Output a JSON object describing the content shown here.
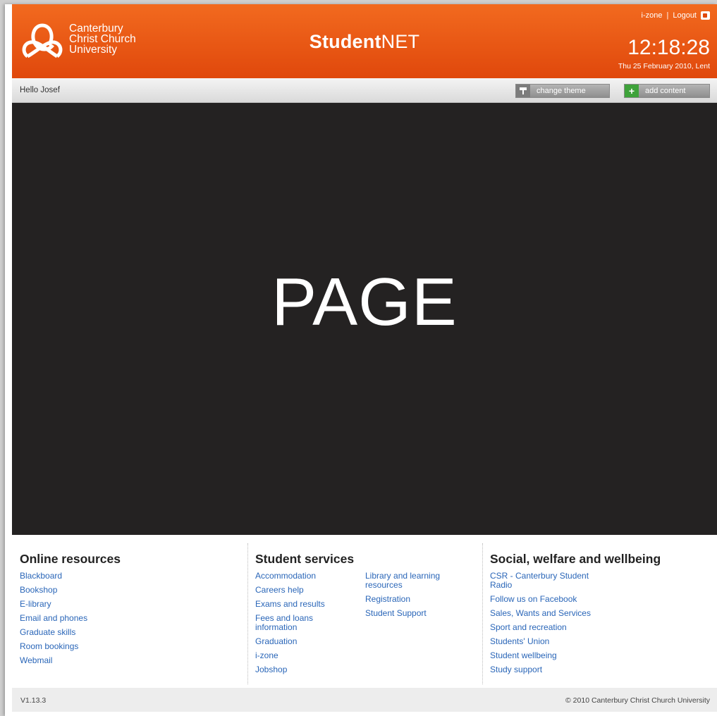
{
  "header": {
    "logo_lines": [
      "Canterbury",
      "Christ Church",
      "University"
    ],
    "site_title_bold": "Student",
    "site_title_rest": "NET",
    "top_links": {
      "izone": "i-zone",
      "separator": "|",
      "logout": "Logout"
    },
    "clock": "12:18:28",
    "date": "Thu 25 February 2010, Lent",
    "colors": {
      "brand_orange": "#e0480c"
    }
  },
  "toolbar": {
    "greeting": "Hello Josef",
    "change_theme": "change theme",
    "add_content": "add content",
    "icons": {
      "change_theme": "paint-roller-icon",
      "add_content": "plus-icon"
    }
  },
  "main": {
    "placeholder": "PAGE"
  },
  "footer": {
    "online": {
      "title": "Online resources",
      "items": [
        "Blackboard",
        "Bookshop",
        "E-library",
        "Email and phones",
        "Graduate skills",
        "Room bookings",
        "Webmail"
      ]
    },
    "services": {
      "title": "Student services",
      "items": [
        "Accommodation",
        "Careers help",
        "Exams and results",
        "Fees and loans information",
        "Graduation",
        "i-zone",
        "Jobshop"
      ],
      "items2": [
        "Library and learning resources",
        "Registration",
        "Student Support"
      ]
    },
    "social": {
      "title": "Social, welfare and wellbeing",
      "items": [
        "CSR - Canterbury Student Radio",
        "Follow us on Facebook",
        "Sales, Wants and Services",
        "Sport and recreation",
        "Students' Union",
        "Student wellbeing",
        "Study support"
      ]
    }
  },
  "bottom": {
    "version": "V1.13.3",
    "copyright": "© 2010 Canterbury Christ Church University"
  }
}
